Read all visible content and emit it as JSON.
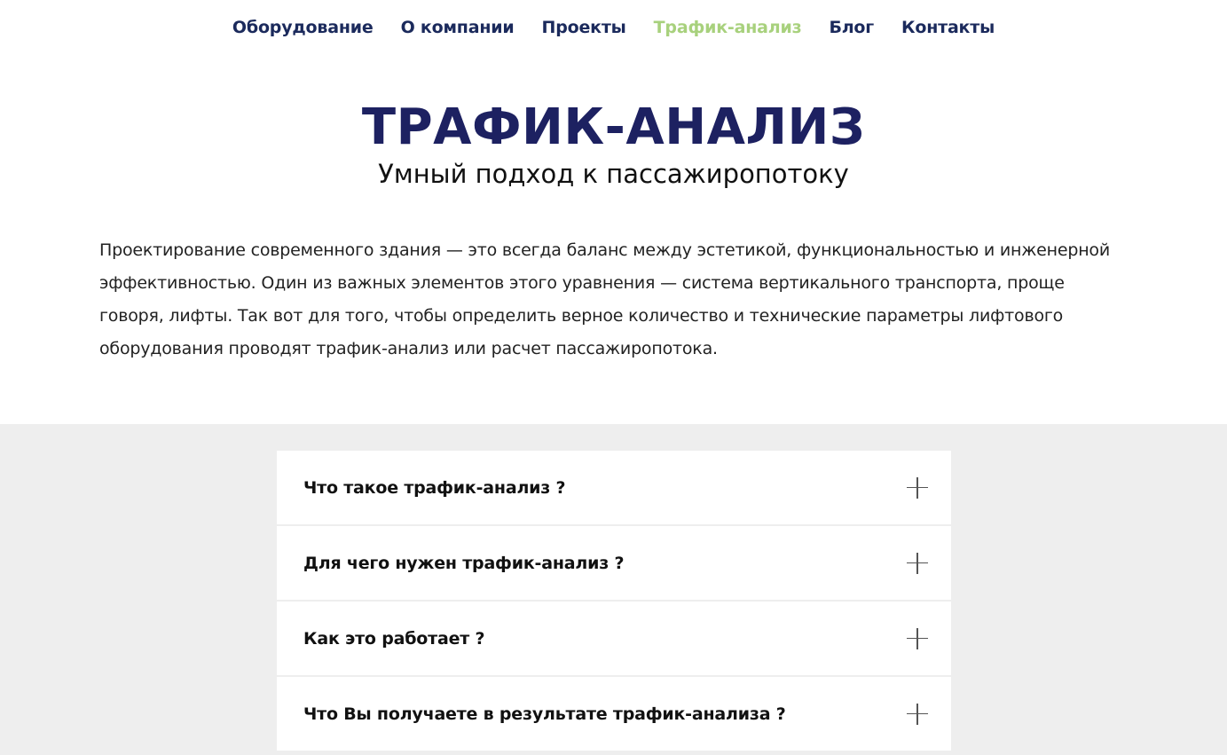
{
  "nav": {
    "items": [
      {
        "label": "Оборудование"
      },
      {
        "label": "О компании"
      },
      {
        "label": "Проекты"
      },
      {
        "label": "Трафик-анализ"
      },
      {
        "label": "Блог"
      },
      {
        "label": "Контакты"
      }
    ],
    "active_label": "Трафик-анализ"
  },
  "hero": {
    "title": "ТРАФИК-АНАЛИЗ",
    "subtitle": "Умный подход к пассажиропотоку"
  },
  "intro": {
    "text": "Проектирование современного здания — это всегда баланс между эстетикой, функциональностью и инженерной эффективностью. Один из важных элементов этого уравнения — система вертикального транспорта, проще говоря, лифты. Так вот для того, чтобы определить верное количество и технические параметры лифтового оборудования проводят трафик-анализ или расчет пассажиропотока."
  },
  "faq": {
    "items": [
      {
        "question": "Что такое трафик-анализ ?",
        "icon": "plus-icon"
      },
      {
        "question": "Для чего нужен трафик-анализ ?",
        "icon": "plus-icon"
      },
      {
        "question": "Как это работает ?",
        "icon": "plus-icon"
      },
      {
        "question": "Что Вы получаете в результате трафик-анализа ?",
        "icon": "plus-icon"
      }
    ]
  },
  "colors": {
    "nav_text": "#1b2a5c",
    "nav_active": "#a8d17d",
    "title": "#1d2161",
    "band": "#eeeeee"
  }
}
